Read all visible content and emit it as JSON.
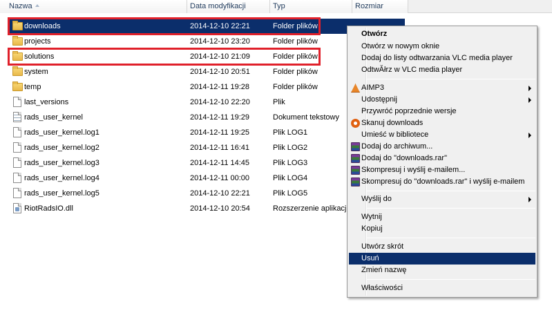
{
  "columns": {
    "name": "Nazwa",
    "date": "Data modyfikacji",
    "type": "Typ",
    "size": "Rozmiar"
  },
  "files": [
    {
      "name": "downloads",
      "date": "2014-12-10 22:21",
      "type": "Folder plików",
      "icon": "folder-icon",
      "selected": true
    },
    {
      "name": "projects",
      "date": "2014-12-10 23:20",
      "type": "Folder plików",
      "icon": "folder-icon"
    },
    {
      "name": "solutions",
      "date": "2014-12-10 21:09",
      "type": "Folder plików",
      "icon": "folder-icon"
    },
    {
      "name": "system",
      "date": "2014-12-10 20:51",
      "type": "Folder plików",
      "icon": "folder-icon"
    },
    {
      "name": "temp",
      "date": "2014-12-11 19:28",
      "type": "Folder plików",
      "icon": "folder-icon"
    },
    {
      "name": "last_versions",
      "date": "2014-12-10 22:20",
      "type": "Plik",
      "icon": "file-icon"
    },
    {
      "name": "rads_user_kernel",
      "date": "2014-12-11 19:29",
      "type": "Dokument tekstowy",
      "icon": "text-file-icon"
    },
    {
      "name": "rads_user_kernel.log1",
      "date": "2014-12-11 19:25",
      "type": "Plik LOG1",
      "icon": "file-icon"
    },
    {
      "name": "rads_user_kernel.log2",
      "date": "2014-12-11 16:41",
      "type": "Plik LOG2",
      "icon": "file-icon"
    },
    {
      "name": "rads_user_kernel.log3",
      "date": "2014-12-11 14:45",
      "type": "Plik LOG3",
      "icon": "file-icon"
    },
    {
      "name": "rads_user_kernel.log4",
      "date": "2014-12-11 00:00",
      "type": "Plik LOG4",
      "icon": "file-icon"
    },
    {
      "name": "rads_user_kernel.log5",
      "date": "2014-12-10 22:21",
      "type": "Plik LOG5",
      "icon": "file-icon"
    },
    {
      "name": "RiotRadsIO.dll",
      "date": "2014-12-10 20:54",
      "type": "Rozszerzenie aplikacji",
      "icon": "dll-file-icon"
    }
  ],
  "context_menu": {
    "items": [
      {
        "label": "Otwórz",
        "bold": true
      },
      {
        "label": "Otwórz w nowym oknie"
      },
      {
        "label": "Dodaj do listy odtwarzania VLC media player"
      },
      {
        "label": "OdtwĂłrz w VLC media player"
      },
      {
        "label": "AIMP3",
        "icon": "aimp-icon",
        "submenu": true
      },
      {
        "label": "Udostępnij",
        "submenu": true
      },
      {
        "label": "Przywróć poprzednie wersje"
      },
      {
        "label": "Skanuj downloads",
        "icon": "avast-icon"
      },
      {
        "label": "Umieść w bibliotece",
        "submenu": true
      },
      {
        "label": "Dodaj do archiwum...",
        "icon": "winrar-icon"
      },
      {
        "label": "Dodaj do \"downloads.rar\"",
        "icon": "winrar-icon"
      },
      {
        "label": "Skompresuj i wyślij e-mailem...",
        "icon": "winrar-icon"
      },
      {
        "label": "Skompresuj do \"downloads.rar\" i wyślij e-mailem",
        "icon": "winrar-icon"
      },
      {
        "label": "Wyślij do",
        "submenu": true
      },
      {
        "label": "Wytnij"
      },
      {
        "label": "Kopiuj"
      },
      {
        "label": "Utwórz skrót"
      },
      {
        "label": "Usuń",
        "highlighted": true
      },
      {
        "label": "Zmień nazwę"
      },
      {
        "label": "Właściwości"
      }
    ]
  },
  "colors": {
    "selection": "#0b2e6b",
    "highlight_box": "#e0202a"
  }
}
